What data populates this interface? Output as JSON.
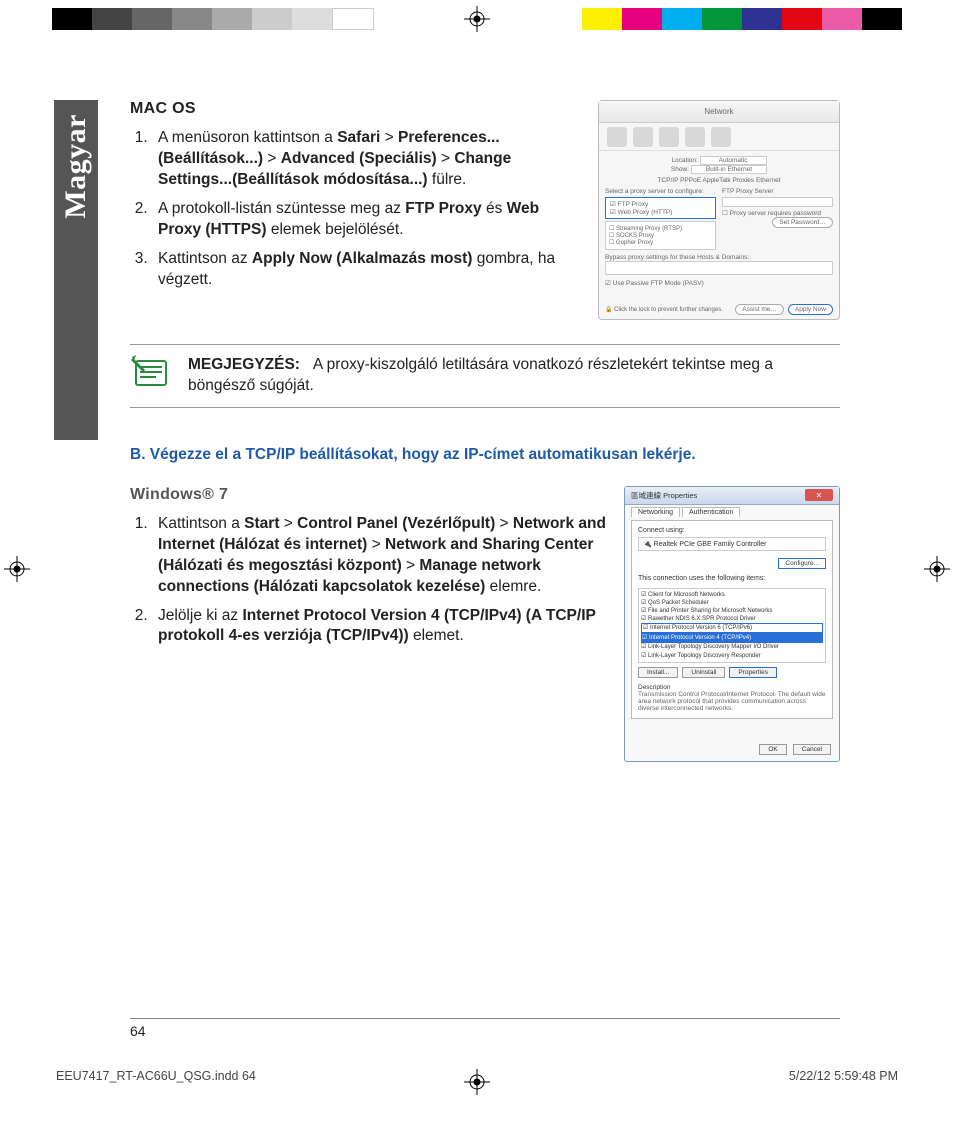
{
  "language_tab": "Magyar",
  "mac": {
    "heading": "MAC OS",
    "steps": [
      {
        "pre": "A menüsoron kattintson a ",
        "b1": "Safari",
        "sep1": " > ",
        "b2": "Preferences... (Beállítások...)",
        "sep2": " > ",
        "b3": "Advanced (Speciális)",
        "sep3": " > ",
        "b4": "Change  Settings...(Beállítások módosítása...)",
        "post": " fülre."
      },
      {
        "pre": "A protokoll-listán szüntesse meg az ",
        "b1": "FTP Proxy",
        "mid": " és ",
        "b2": "Web Proxy (HTTPS)",
        "post": " elemek bejelölését."
      },
      {
        "pre": "Kattintson az ",
        "b1": "Apply Now (Alkalmazás most)",
        "post": " gombra, ha végzett."
      }
    ],
    "shot": {
      "title": "Network",
      "loc_label": "Location:",
      "loc_val": "Automatic",
      "show_label": "Show:",
      "show_val": "Built-in Ethernet",
      "tabs": "TCP/IP   PPPoE   AppleTalk   Proxies   Ethernet",
      "select": "Select a proxy server to configure:",
      "fps": "FTP Proxy Server",
      "p1": "FTP Proxy",
      "p2": "Web Proxy (HTTP)",
      "p3": "Streaming Proxy (RTSP)",
      "p4": "SOCKS Proxy",
      "p5": "Gopher Proxy",
      "psr": "Proxy server requires password",
      "setpw": "Set Password…",
      "bypass": "Bypass proxy settings for these Hosts & Domains:",
      "pasv": "Use Passive FTP Mode (PASV)",
      "lock": "Click the lock to prevent further changes.",
      "assist": "Assist me…",
      "apply": "Apply Now"
    }
  },
  "note": {
    "label": "MEGJEGYZÉS:",
    "text": "A proxy-kiszolgáló letiltására vonatkozó részletekért tekintse meg a böngésző súgóját."
  },
  "sectionB": "B.   Végezze el a TCP/IP beállításokat, hogy az IP-címet automatikusan lekérje.",
  "win": {
    "heading": "Windows® 7",
    "steps": [
      {
        "pre": "Kattintson a ",
        "b1": "Start",
        "sep1": " > ",
        "b2": "Control Panel (Vezérlőpult)",
        "sep2": " > ",
        "b3": "Network and Internet (Hálózat és internet)",
        "sep3": " > ",
        "b4": "Network and Sharing Center (Hálózati és megosztási központ)",
        "sep4": " > ",
        "b5": "Manage network connections (Hálózati kapcsolatok kezelése)",
        "post": " elemre."
      },
      {
        "pre": "Jelölje ki az ",
        "b1": "Internet Protocol Version 4 (TCP/IPv4) (A TCP/IP protokoll 4-es verziója (TCP/IPv4))",
        "post": " elemet."
      }
    ],
    "shot": {
      "title": "區域連線 Properties",
      "tab_net": "Networking",
      "tab_auth": "Authentication",
      "connect": "Connect using:",
      "adapter": "Realtek PCIe GBE Family Controller",
      "cfg": "Configure...",
      "uses": "This connection uses the following items:",
      "i1": "Client for Microsoft Networks",
      "i2": "QoS Packet Scheduler",
      "i3": "File and Printer Sharing for Microsoft Networks",
      "i4": "Rawether NDIS 6.X SPR Protocol Driver",
      "i5": "Internet Protocol Version 6 (TCP/IPv6)",
      "i6": "Internet Protocol Version 4 (TCP/IPv4)",
      "i7": "Link-Layer Topology Discovery Mapper I/O Driver",
      "i8": "Link-Layer Topology Discovery Responder",
      "install": "Install...",
      "uninstall": "Uninstall",
      "props": "Properties",
      "desc_h": "Description",
      "desc": "Transmission Control Protocol/Internet Protocol. The default wide area network protocol that provides communication across diverse interconnected networks.",
      "ok": "OK",
      "cancel": "Cancel"
    }
  },
  "page_number": "64",
  "footer": {
    "file": "EEU7417_RT-AC66U_QSG.indd   64",
    "date": "5/22/12   5:59:48 PM"
  }
}
